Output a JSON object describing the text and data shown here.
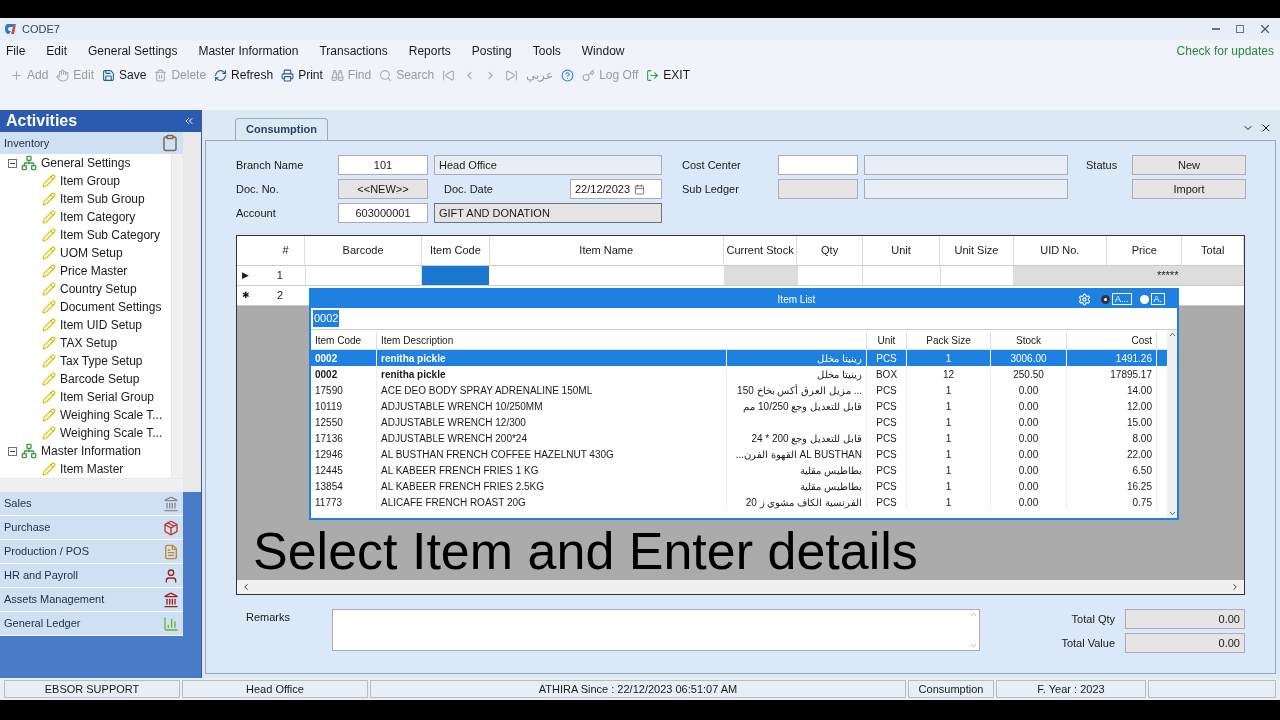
{
  "window": {
    "title": "CODE7",
    "update_link": "Check for updates"
  },
  "menu": [
    "File",
    "Edit",
    "General Settings",
    "Master Information",
    "Transactions",
    "Reports",
    "Posting",
    "Tools",
    "Window"
  ],
  "toolbar": [
    {
      "kind": "plus",
      "label": "Add",
      "disabled": true
    },
    {
      "kind": "hand",
      "label": "Edit",
      "disabled": true
    },
    {
      "kind": "save",
      "label": "Save",
      "disabled": false
    },
    {
      "kind": "trash",
      "label": "Delete",
      "disabled": true
    },
    {
      "kind": "refresh",
      "label": "Refresh",
      "disabled": false
    },
    {
      "kind": "print",
      "label": "Print",
      "disabled": false
    },
    {
      "kind": "binoculars",
      "label": "Find",
      "disabled": true
    },
    {
      "kind": "search",
      "label": "Search",
      "disabled": true
    },
    {
      "kind": "first",
      "disabled": true
    },
    {
      "kind": "prev",
      "disabled": true
    },
    {
      "kind": "next",
      "disabled": true
    },
    {
      "kind": "last",
      "disabled": true
    },
    {
      "kind": "text",
      "label": "عربي",
      "disabled": true
    },
    {
      "kind": "help",
      "disabled": false
    },
    {
      "kind": "key",
      "label": "Log Off",
      "disabled": true
    },
    {
      "kind": "exit",
      "label": "EXIT",
      "disabled": false
    }
  ],
  "sidebar": {
    "title": "Activities",
    "active_section": "Inventory",
    "tree": [
      {
        "label": "General Settings",
        "expanded": true,
        "children": [
          {
            "label": "Item Group"
          },
          {
            "label": "Item Sub Group"
          },
          {
            "label": "Item Category"
          },
          {
            "label": "Item Sub Category"
          },
          {
            "label": "UOM Setup"
          },
          {
            "label": "Price Master"
          },
          {
            "label": "Country Setup"
          },
          {
            "label": "Document Settings"
          },
          {
            "label": "Item UID Setup"
          },
          {
            "label": "TAX Setup"
          },
          {
            "label": "Tax Type Setup"
          },
          {
            "label": "Barcode Setup"
          },
          {
            "label": "Item Serial Group"
          },
          {
            "label": "Weighing Scale T..."
          },
          {
            "label": "Weighing Scale T..."
          }
        ]
      },
      {
        "label": "Master Information",
        "expanded": true,
        "children": [
          {
            "label": "Item Master"
          }
        ]
      }
    ],
    "sections": [
      {
        "label": "Sales",
        "kind": "bank"
      },
      {
        "label": "Purchase",
        "kind": "boxes"
      },
      {
        "label": "Production / POS",
        "kind": "doc"
      },
      {
        "label": "HR and Payroll",
        "kind": "person"
      },
      {
        "label": "Assets Management",
        "kind": "building"
      },
      {
        "label": "General Ledger",
        "kind": "bars"
      }
    ]
  },
  "tab": {
    "label": "Consumption",
    "selected": true
  },
  "form": {
    "branch_name_label": "Branch Name",
    "branch_code": "101",
    "branch_name": "Head Office",
    "doc_no_label": "Doc. No.",
    "doc_no": "<<NEW>>",
    "doc_date_label": "Doc. Date",
    "doc_date": "22/12/2023",
    "account_label": "Account",
    "account_code": "603000001",
    "account_name": "GIFT AND DONATION",
    "cost_center_label": "Cost Center",
    "sub_ledger_label": "Sub Ledger",
    "status_label": "Status",
    "status": "New",
    "import_button": "Import"
  },
  "grid": {
    "columns": [
      "#",
      "Barcode",
      "Item Code",
      "Item Name",
      "Current Stock",
      "Qty",
      "Unit",
      "Unit Size",
      "UID No.",
      "Price",
      "Total"
    ],
    "rows": [
      {
        "marker": "▶",
        "number": "1",
        "price": "*****"
      },
      {
        "marker": "✱",
        "number": "2"
      }
    ]
  },
  "item_list": {
    "title": "Item List",
    "search": "0002",
    "option_1": {
      "label": "A...",
      "selected": true
    },
    "option_2": {
      "label": "A.",
      "selected": false
    },
    "columns": [
      "Item Code",
      "Item Description",
      "Unit",
      "Pack Size",
      "Stock",
      "Cost"
    ],
    "rows": [
      {
        "code": "0002",
        "description": "renitha pickle",
        "arabic": "رينيتا مخلل",
        "unit": "PCS",
        "pack": "1",
        "stock": "3006.00",
        "cost": "1491.26",
        "selected": true,
        "bold": true
      },
      {
        "code": "0002",
        "description": "renitha pickle",
        "arabic": "رينيتا مخلل",
        "unit": "BOX",
        "pack": "12",
        "stock": "250.50",
        "cost": "17895.17",
        "selected": false,
        "bold": true
      },
      {
        "code": "17590",
        "description": "ACE DEO BODY SPRAY ADRENALINE 150ML",
        "arabic": "... مزيل العرق أكس بخاخ 150",
        "unit": "PCS",
        "pack": "1",
        "stock": "0.00",
        "cost": "14.00",
        "selected": false,
        "bold": false
      },
      {
        "code": "10119",
        "description": "ADJUSTABLE WRENCH 10/250MM",
        "arabic": "قابل للتعديل وجع 10/250 مم",
        "unit": "PCS",
        "pack": "1",
        "stock": "0.00",
        "cost": "12.00",
        "selected": false,
        "bold": false
      },
      {
        "code": "12550",
        "description": "ADJUSTABLE WRENCH 12/300",
        "unit": "PCS",
        "pack": "1",
        "stock": "0.00",
        "cost": "15.00",
        "selected": false,
        "bold": false
      },
      {
        "code": "17136",
        "description": "ADJUSTABLE WRENCH 200*24",
        "arabic": "قابل للتعديل وجع 200 * 24",
        "unit": "PCS",
        "pack": "1",
        "stock": "0.00",
        "cost": "8.00",
        "selected": false,
        "bold": false
      },
      {
        "code": "12946",
        "description": "AL BUSTHAN FRENCH COFFEE HAZELNUT 430G",
        "arabic": "AL BUSTHAN القهوة الفرن...",
        "unit": "PCS",
        "pack": "1",
        "stock": "0.00",
        "cost": "22.00",
        "selected": false,
        "bold": false
      },
      {
        "code": "12445",
        "description": "AL KABEER FRENCH FRIES 1 KG",
        "arabic": "بطاطيس مقلية",
        "unit": "PCS",
        "pack": "1",
        "stock": "0.00",
        "cost": "6.50",
        "selected": false,
        "bold": false
      },
      {
        "code": "13854",
        "description": "AL KABEER FRENCH FRIES 2.5KG",
        "arabic": "بطاطيس مقلية",
        "unit": "PCS",
        "pack": "1",
        "stock": "0.00",
        "cost": "16.25",
        "selected": false,
        "bold": false
      },
      {
        "code": "11773",
        "description": "ALICAFE FRENCH ROAST 20G",
        "arabic": "الفرنسية الكاف مشوي ز 20",
        "unit": "PCS",
        "pack": "1",
        "stock": "0.00",
        "cost": "0.75",
        "selected": false,
        "bold": false
      }
    ]
  },
  "caption": "Select Item and Enter details",
  "footer": {
    "remarks_label": "Remarks",
    "total_qty_label": "Total Qty",
    "total_qty": "0.00",
    "total_value_label": "Total Value",
    "total_value": "0.00"
  },
  "status_bar": [
    "EBSOR SUPPORT",
    "Head Office",
    "ATHIRA Since : 22/12/2023 06:51:07 AM",
    "Consumption",
    "F. Year : 2023"
  ]
}
